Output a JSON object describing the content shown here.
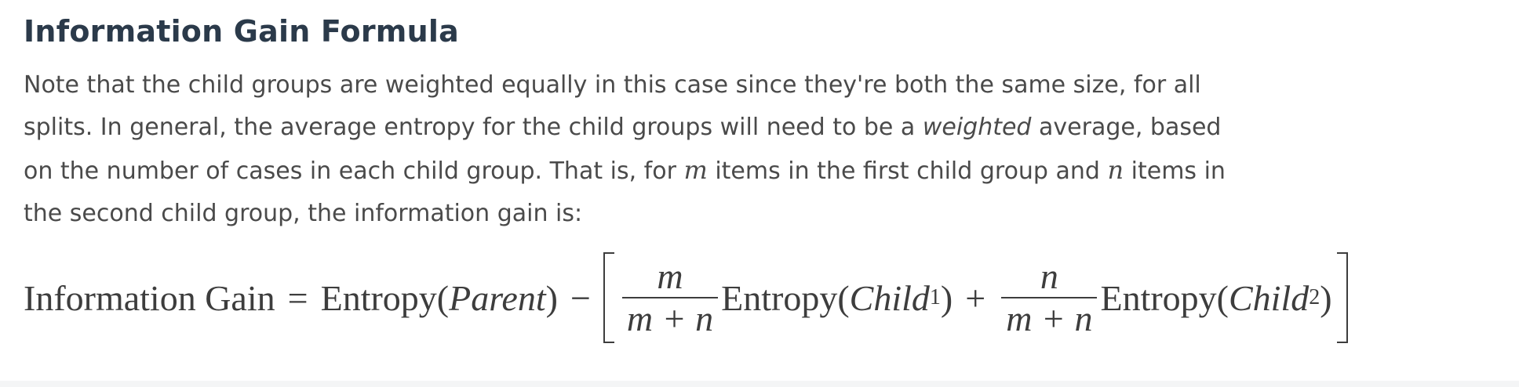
{
  "heading": "Information Gain Formula",
  "paragraph": {
    "p1": "Note that the child groups are weighted equally in this case since they're both the same size, for all splits. In general, the average entropy for the child groups will need to be a ",
    "em": "weighted",
    "p2": " average, based on the number of cases in each child group. That is, for ",
    "var_m": "m",
    "p3": " items in the first child group and ",
    "var_n": "n",
    "p4": " items in the second child group, the information gain is:"
  },
  "equation": {
    "lhs": "Information Gain",
    "equals": "=",
    "entropy1": "Entropy(",
    "parent": "Parent",
    "close1": ")",
    "minus": "−",
    "frac1_num": "m",
    "frac1_den": "m + n",
    "entropy2": "Entropy(",
    "child": "Child",
    "sub1": "1",
    "close2": ")",
    "plus": "+",
    "frac2_num": "n",
    "frac2_den": "m + n",
    "entropy3": "Entropy(",
    "child2": "Child",
    "sub2": "2",
    "close3": ")"
  }
}
